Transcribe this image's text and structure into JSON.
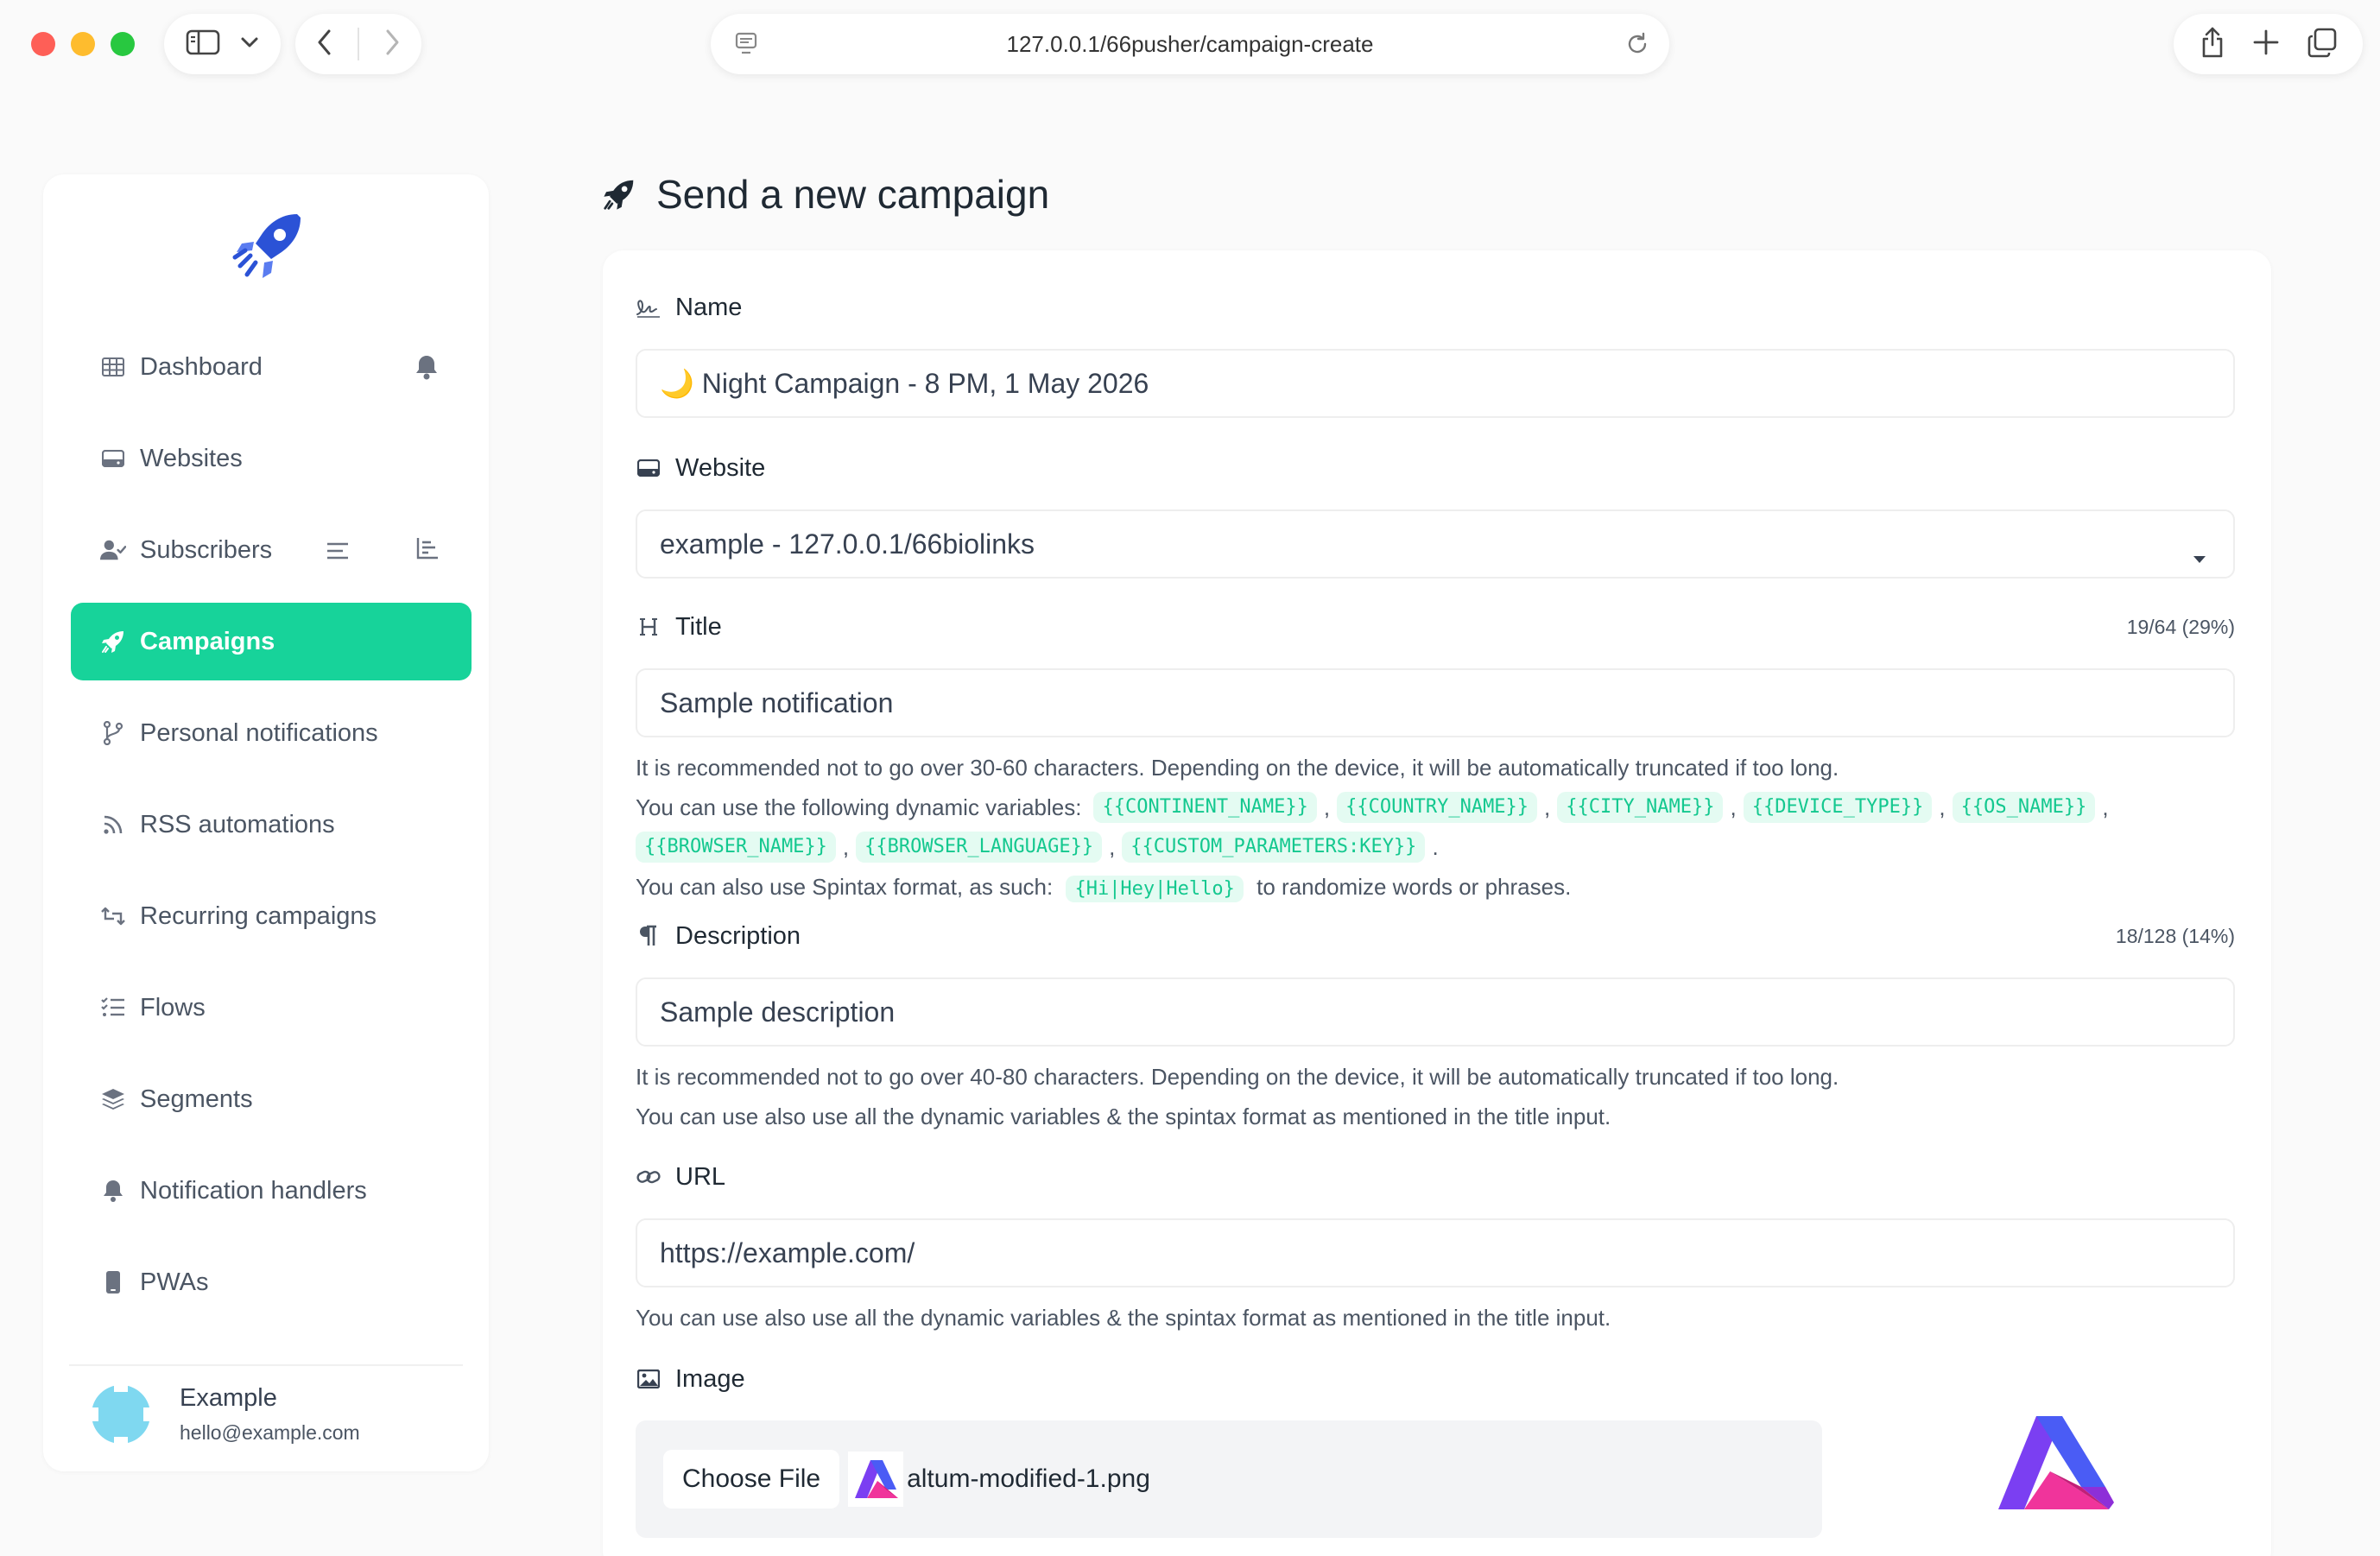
{
  "browser": {
    "url": "127.0.0.1/66pusher/campaign-create"
  },
  "sidebar": {
    "items": [
      {
        "label": "Dashboard",
        "icon": "table-icon"
      },
      {
        "label": "Websites",
        "icon": "hdd-icon"
      },
      {
        "label": "Subscribers",
        "icon": "user-check-icon"
      },
      {
        "label": "Campaigns",
        "icon": "rocket-icon",
        "active": true
      },
      {
        "label": "Personal notifications",
        "icon": "code-branch-icon"
      },
      {
        "label": "RSS automations",
        "icon": "rss-icon"
      },
      {
        "label": "Recurring campaigns",
        "icon": "retweet-icon"
      },
      {
        "label": "Flows",
        "icon": "tasks-icon"
      },
      {
        "label": "Segments",
        "icon": "layers-icon"
      },
      {
        "label": "Notification handlers",
        "icon": "bell-icon"
      },
      {
        "label": "PWAs",
        "icon": "mobile-icon"
      }
    ],
    "user": {
      "name": "Example",
      "email": "hello@example.com"
    }
  },
  "page": {
    "title": "Send a new campaign"
  },
  "form": {
    "name": {
      "label": "Name",
      "value": "🌙 Night Campaign - 8 PM, 1 May 2026"
    },
    "website": {
      "label": "Website",
      "value": "example - 127.0.0.1/66biolinks"
    },
    "title": {
      "label": "Title",
      "counter": "19/64 (29%)",
      "value": "Sample notification",
      "help_1": "It is recommended not to go over 30-60 characters. Depending on the device, it will be automatically truncated if too long.",
      "vars_intro": "You can use the following dynamic variables:",
      "variables": [
        "{{CONTINENT_NAME}}",
        "{{COUNTRY_NAME}}",
        "{{CITY_NAME}}",
        "{{DEVICE_TYPE}}",
        "{{OS_NAME}}",
        "{{BROWSER_NAME}}",
        "{{BROWSER_LANGUAGE}}",
        "{{CUSTOM_PARAMETERS:KEY}}"
      ],
      "spintax_intro": "You can also use Spintax format, as such:",
      "spintax_example": "{Hi|Hey|Hello}",
      "spintax_outro": "to randomize words or phrases."
    },
    "description": {
      "label": "Description",
      "counter": "18/128 (14%)",
      "value": "Sample description",
      "help_1": "It is recommended not to go over 40-80 characters. Depending on the device, it will be automatically truncated if too long.",
      "help_2": "You can use also use all the dynamic variables & the spintax format as mentioned in the title input."
    },
    "url": {
      "label": "URL",
      "value": "https://example.com/",
      "help": "You can use also use all the dynamic variables & the spintax format as mentioned in the title input."
    },
    "image": {
      "label": "Image",
      "button": "Choose File",
      "file_name": "altum-modified-1.png"
    }
  },
  "colors": {
    "accent": "#17d39a",
    "tag_text": "#14c88f",
    "tag_bg": "#e4fbf2"
  }
}
